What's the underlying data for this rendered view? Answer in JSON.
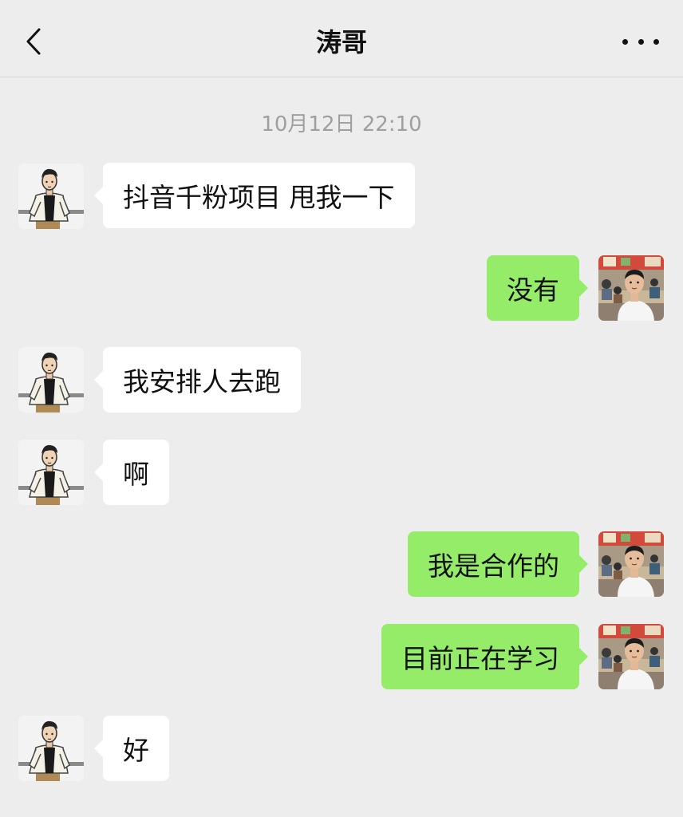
{
  "header": {
    "title": "涛哥",
    "back_icon": "chevron-left-icon",
    "more_icon": "more-dots-icon"
  },
  "timestamp": "10月12日 22:10",
  "colors": {
    "background": "#ededed",
    "incoming_bubble": "#ffffff",
    "outgoing_bubble": "#95ec69"
  },
  "messages": [
    {
      "sender": "涛哥",
      "text": "抖音千粉项目 甩我一下"
    },
    {
      "sender": "me",
      "text": "没有"
    },
    {
      "sender": "涛哥",
      "text": "我安排人去跑"
    },
    {
      "sender": "涛哥",
      "text": "啊"
    },
    {
      "sender": "me",
      "text": "我是合作的"
    },
    {
      "sender": "me",
      "text": "目前正在学习"
    },
    {
      "sender": "涛哥",
      "text": "好"
    }
  ]
}
